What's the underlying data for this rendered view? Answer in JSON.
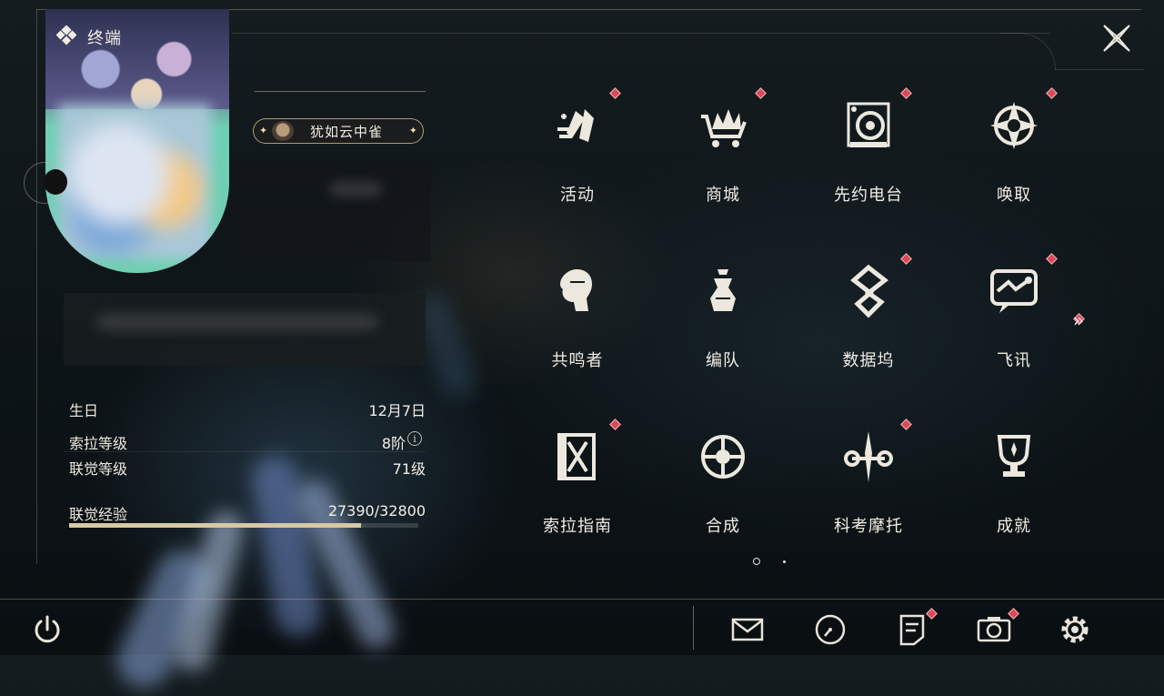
{
  "header": {
    "title": "终端"
  },
  "profile": {
    "title_badge": "犹如云中雀",
    "stats": [
      {
        "label": "生日",
        "value": "12月7日"
      },
      {
        "label": "索拉等级",
        "value": "8阶"
      },
      {
        "label": "联觉等级",
        "value": "71级"
      }
    ],
    "xp": {
      "label": "联觉经验",
      "value": "27390/32800",
      "current": 27390,
      "max": 32800
    }
  },
  "menu": [
    {
      "label": "活动",
      "icon": "activity-icon",
      "badge": true
    },
    {
      "label": "商城",
      "icon": "shop-icon",
      "badge": true
    },
    {
      "label": "先约电台",
      "icon": "radio-icon",
      "badge": true
    },
    {
      "label": "唤取",
      "icon": "convene-icon",
      "badge": true
    },
    {
      "label": "共鸣者",
      "icon": "resonator-icon",
      "badge": false
    },
    {
      "label": "编队",
      "icon": "team-icon",
      "badge": false
    },
    {
      "label": "数据坞",
      "icon": "data-bank-icon",
      "badge": true
    },
    {
      "label": "飞讯",
      "icon": "message-icon",
      "badge": true
    },
    {
      "label": "索拉指南",
      "icon": "guide-icon",
      "badge": true
    },
    {
      "label": "合成",
      "icon": "synthesis-icon",
      "badge": false
    },
    {
      "label": "科考摩托",
      "icon": "motorcycle-icon",
      "badge": true
    },
    {
      "label": "成就",
      "icon": "achievement-icon",
      "badge": false
    }
  ],
  "pagination": {
    "current": 1,
    "total": 2
  },
  "bottom_bar": {
    "items": [
      {
        "icon": "mail-icon",
        "badge": false
      },
      {
        "icon": "clock-icon",
        "badge": false
      },
      {
        "icon": "notes-icon",
        "badge": true
      },
      {
        "icon": "camera-icon",
        "badge": true
      },
      {
        "icon": "settings-icon",
        "badge": false
      }
    ]
  },
  "colors": {
    "accent": "#d7c9a3",
    "badge_red": "#d84a5a",
    "text": "#f1ede4"
  }
}
